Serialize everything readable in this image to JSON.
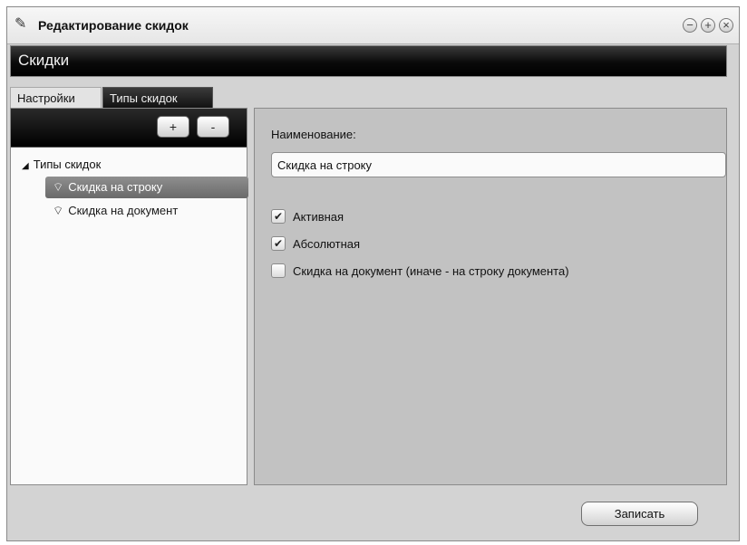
{
  "window": {
    "title": "Редактирование скидок",
    "icon": "pencil-icon",
    "controls": [
      "minimize-icon",
      "maximize-icon",
      "close-icon"
    ]
  },
  "header": {
    "title": "Скидки"
  },
  "tabs": [
    {
      "label": "Настройки",
      "active": false
    },
    {
      "label": "Типы скидок",
      "active": true
    }
  ],
  "left_toolbar": {
    "add_label": "+",
    "remove_label": "-"
  },
  "tree": {
    "root_label": "Типы скидок",
    "items": [
      {
        "label": "Скидка на строку",
        "selected": true,
        "icon": "tag-icon"
      },
      {
        "label": "Скидка на документ",
        "selected": false,
        "icon": "tag-icon"
      }
    ]
  },
  "form": {
    "name_label": "Наименование:",
    "name_value": "Скидка на строку",
    "checkboxes": [
      {
        "label": "Активная",
        "checked": true
      },
      {
        "label": "Абсолютная",
        "checked": true
      },
      {
        "label": "Скидка на документ (иначе - на строку документа)",
        "checked": false
      }
    ]
  },
  "footer": {
    "save_label": "Записать"
  }
}
